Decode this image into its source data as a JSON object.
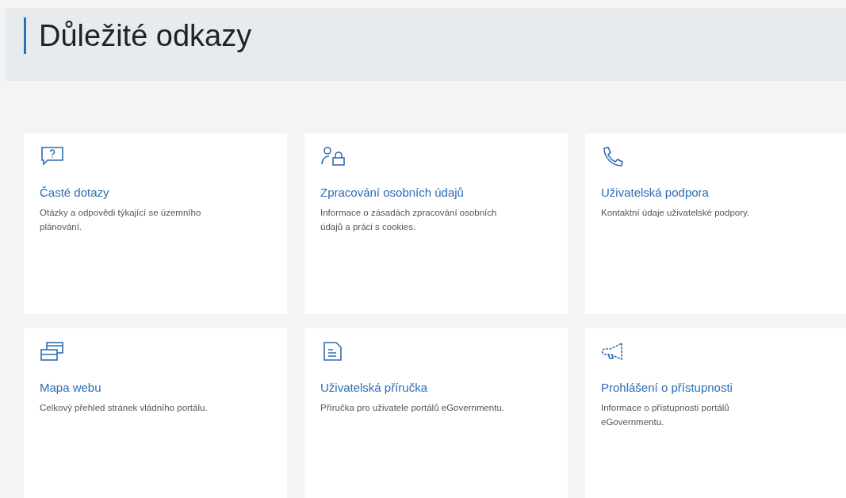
{
  "heading": "Důležité odkazy",
  "cards": [
    {
      "kind": "faq",
      "title": "Časté dotazy",
      "description": "Otázky a odpovědi týkající se územního plánování."
    },
    {
      "kind": "privacy",
      "title": "Zpracování osobních údajů",
      "description": "Informace o zásadách zpracování osobních údajů a práci s cookies."
    },
    {
      "kind": "phone",
      "title": "Uživatelská podpora",
      "description": "Kontaktní údaje uživatelské podpory."
    },
    {
      "kind": "sitemap",
      "title": "Mapa webu",
      "description": "Celkový přehled stránek vládního portálu."
    },
    {
      "kind": "manual",
      "title": "Uživatelská příručka",
      "description": "Příručka pro uživatele portálů eGovernmentu."
    },
    {
      "kind": "megaphone",
      "title": "Prohlášení o přístupnosti",
      "description": "Informace o přístupnosti portálů eGovernmentu."
    }
  ]
}
